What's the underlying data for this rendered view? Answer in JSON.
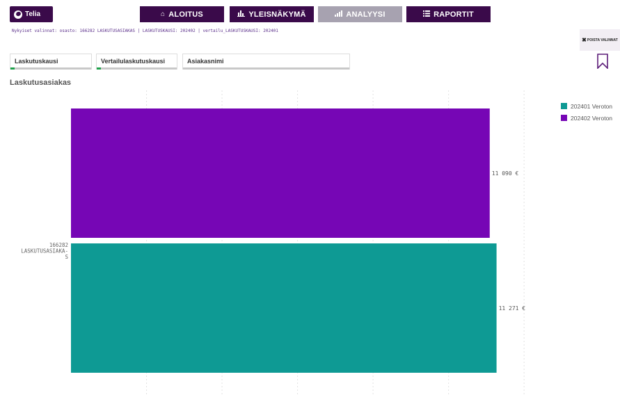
{
  "header": {
    "logo_text": "Telia",
    "nav": [
      {
        "label": "ALOITUS",
        "icon": "home-icon"
      },
      {
        "label": "YLEISNÄKYMÄ",
        "icon": "bar-chart-icon"
      },
      {
        "label": "ANALYYSI",
        "icon": "analysis-icon",
        "active": true
      },
      {
        "label": "RAPORTIT",
        "icon": "grid-icon"
      }
    ]
  },
  "selections_text": "Nykyiset valinnat: osasto: 166282 LASKUTUSASIAKAS | LASKUTUSKAUSI: 202402 | vertailu_LASKUTUSKAUSI: 202401",
  "clear_button_label": "POISTA VALINNAT",
  "filters": [
    {
      "label": "Laskutuskausi",
      "selected": true
    },
    {
      "label": "Vertailulaskutuskausi",
      "selected": true
    },
    {
      "label": "Asiakasnimi",
      "selected": false
    }
  ],
  "section_title": "Laskutusasiakas",
  "colors": {
    "brand": "#3a0a4a",
    "active_nav": "#a7a2b0",
    "series_202401": "#0e9a94",
    "series_202402": "#7606b5"
  },
  "chart_data": {
    "type": "bar",
    "orientation": "horizontal",
    "categories": [
      "166282 LASKUTUSASIAKA-S"
    ],
    "category_lines": [
      [
        "166282",
        "LASKUTUSASIAKA-",
        "S"
      ]
    ],
    "series": [
      {
        "name": "202402 Veroton",
        "values": [
          11090
        ],
        "value_labels": [
          "11 090 €"
        ],
        "color": "#7606b5"
      },
      {
        "name": "202401 Veroton",
        "values": [
          11271
        ],
        "value_labels": [
          "11 271 €"
        ],
        "color": "#0e9a94"
      }
    ],
    "legend": [
      "202401 Veroton",
      "202402 Veroton"
    ],
    "legend_colors": [
      "#0e9a94",
      "#7606b5"
    ],
    "xlim": [
      0,
      12200
    ],
    "grid": true,
    "legend_position": "top-right"
  }
}
